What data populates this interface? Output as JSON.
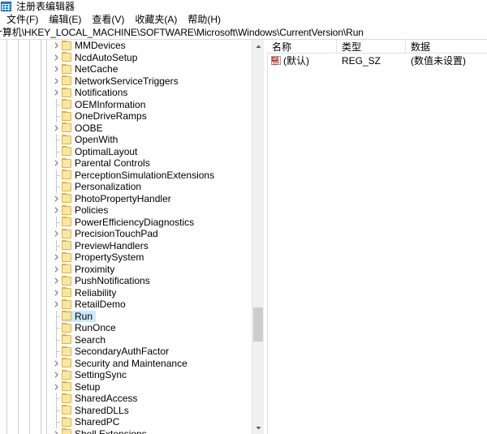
{
  "window": {
    "title": "注册表编辑器",
    "icon": "registry-editor-icon"
  },
  "menubar": {
    "items": [
      {
        "label": "文件(F)",
        "name": "menu-file"
      },
      {
        "label": "编辑(E)",
        "name": "menu-edit"
      },
      {
        "label": "查看(V)",
        "name": "menu-view"
      },
      {
        "label": "收藏夹(A)",
        "name": "menu-favorites"
      },
      {
        "label": "帮助(H)",
        "name": "menu-help"
      }
    ]
  },
  "address": {
    "path": "计算机\\HKEY_LOCAL_MACHINE\\SOFTWARE\\Microsoft\\Windows\\CurrentVersion\\Run"
  },
  "tree": {
    "nodes": [
      {
        "label": "MMDevices",
        "expandable": true,
        "selected": false
      },
      {
        "label": "NcdAutoSetup",
        "expandable": true,
        "selected": false
      },
      {
        "label": "NetCache",
        "expandable": true,
        "selected": false
      },
      {
        "label": "NetworkServiceTriggers",
        "expandable": true,
        "selected": false
      },
      {
        "label": "Notifications",
        "expandable": true,
        "selected": false
      },
      {
        "label": "OEMInformation",
        "expandable": false,
        "selected": false
      },
      {
        "label": "OneDriveRamps",
        "expandable": false,
        "selected": false
      },
      {
        "label": "OOBE",
        "expandable": true,
        "selected": false
      },
      {
        "label": "OpenWith",
        "expandable": false,
        "selected": false
      },
      {
        "label": "OptimalLayout",
        "expandable": false,
        "selected": false
      },
      {
        "label": "Parental Controls",
        "expandable": true,
        "selected": false
      },
      {
        "label": "PerceptionSimulationExtensions",
        "expandable": false,
        "selected": false
      },
      {
        "label": "Personalization",
        "expandable": false,
        "selected": false
      },
      {
        "label": "PhotoPropertyHandler",
        "expandable": true,
        "selected": false
      },
      {
        "label": "Policies",
        "expandable": true,
        "selected": false
      },
      {
        "label": "PowerEfficiencyDiagnostics",
        "expandable": false,
        "selected": false
      },
      {
        "label": "PrecisionTouchPad",
        "expandable": true,
        "selected": false
      },
      {
        "label": "PreviewHandlers",
        "expandable": false,
        "selected": false
      },
      {
        "label": "PropertySystem",
        "expandable": true,
        "selected": false
      },
      {
        "label": "Proximity",
        "expandable": true,
        "selected": false
      },
      {
        "label": "PushNotifications",
        "expandable": true,
        "selected": false
      },
      {
        "label": "Reliability",
        "expandable": true,
        "selected": false
      },
      {
        "label": "RetailDemo",
        "expandable": true,
        "selected": false
      },
      {
        "label": "Run",
        "expandable": false,
        "selected": true
      },
      {
        "label": "RunOnce",
        "expandable": false,
        "selected": false
      },
      {
        "label": "Search",
        "expandable": false,
        "selected": false
      },
      {
        "label": "SecondaryAuthFactor",
        "expandable": false,
        "selected": false
      },
      {
        "label": "Security and Maintenance",
        "expandable": true,
        "selected": false
      },
      {
        "label": "SettingSync",
        "expandable": true,
        "selected": false
      },
      {
        "label": "Setup",
        "expandable": true,
        "selected": false
      },
      {
        "label": "SharedAccess",
        "expandable": false,
        "selected": false
      },
      {
        "label": "SharedDLLs",
        "expandable": false,
        "selected": false
      },
      {
        "label": "SharedPC",
        "expandable": false,
        "selected": false
      },
      {
        "label": "Shell Extensions",
        "expandable": true,
        "selected": false
      }
    ]
  },
  "values": {
    "columns": [
      {
        "label": "名称",
        "name": "column-name"
      },
      {
        "label": "类型",
        "name": "column-type"
      },
      {
        "label": "数据",
        "name": "column-data"
      }
    ],
    "rows": [
      {
        "name": "(默认)",
        "type": "REG_SZ",
        "data": "(数值未设置)",
        "icon": "string-value-icon"
      }
    ]
  },
  "scrollbar": {
    "up_arrow": "▲",
    "down_arrow": "▼"
  },
  "colors": {
    "selection": "#cce8ff",
    "folder": "#fbe7a3",
    "titlebar_icon": "#1e87d6",
    "scrollbar_thumb": "#cdcdcd"
  }
}
